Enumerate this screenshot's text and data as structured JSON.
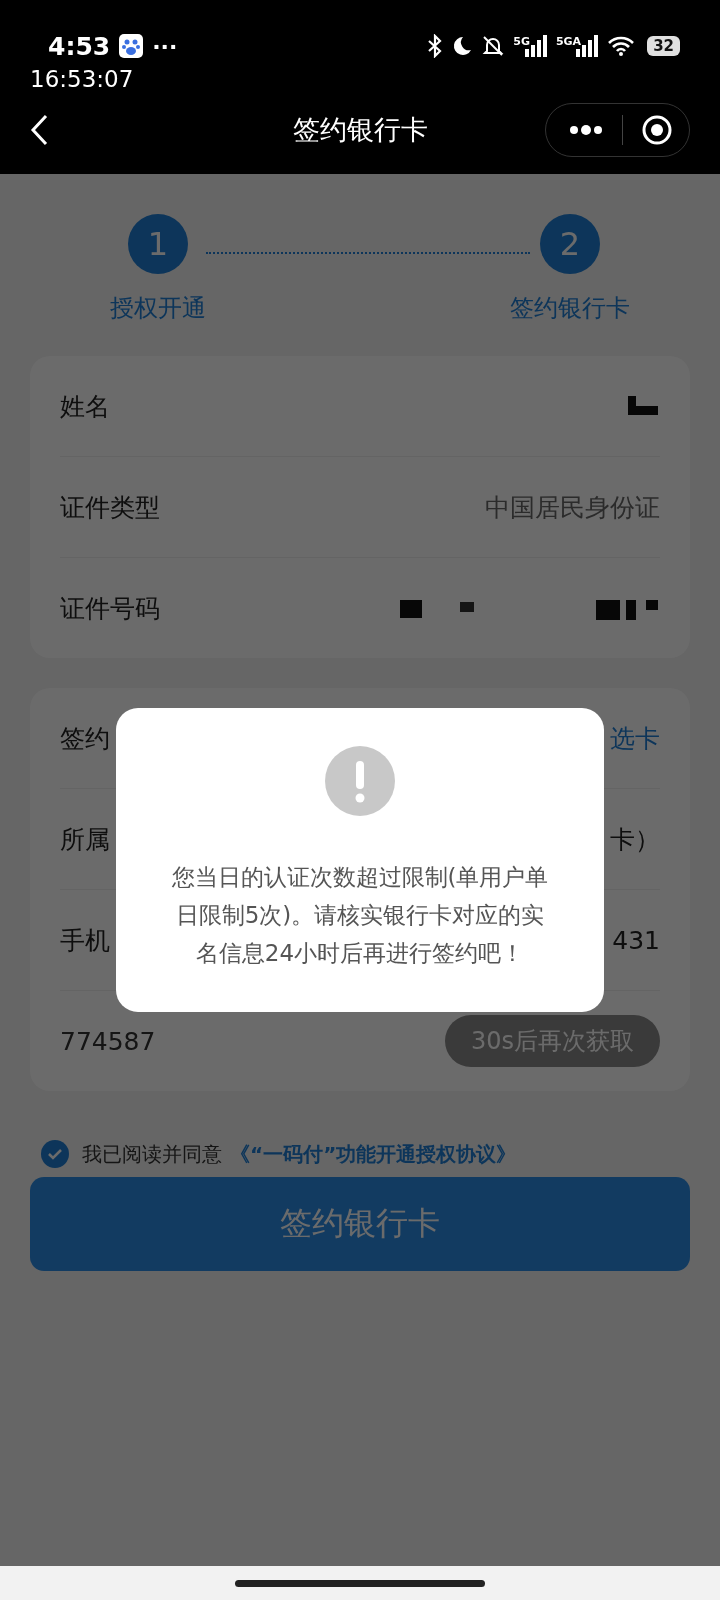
{
  "status_bar": {
    "time": "4:53",
    "more": "···",
    "clock": "16:53:07",
    "network_labels": [
      "5G",
      "5GA"
    ],
    "battery": "32"
  },
  "nav": {
    "title": "签约银行卡"
  },
  "steps": [
    {
      "number": "1",
      "label": "授权开通"
    },
    {
      "number": "2",
      "label": "签约银行卡"
    }
  ],
  "identity_rows": [
    {
      "kind": "redacted",
      "label": "姓名"
    },
    {
      "kind": "text",
      "label": "证件类型",
      "value": "中国居民身份证"
    },
    {
      "kind": "redacted",
      "label": "证件号码"
    }
  ],
  "bank_rows": [
    {
      "kind": "link",
      "label": "签约",
      "value": "选卡"
    },
    {
      "kind": "text",
      "label": "所属",
      "value": "卡）"
    },
    {
      "kind": "text",
      "label": "手机",
      "value": "431"
    },
    {
      "kind": "code",
      "value": "774587",
      "button": "30s后再次获取"
    }
  ],
  "agreement": {
    "checked": true,
    "text": "我已阅读并同意",
    "link": "《“一码付”功能开通授权协议》"
  },
  "submit": {
    "label": "签约银行卡"
  },
  "dialog": {
    "message": "您当日的认证次数超过限制(单用户单日限制5次)。请核实银行卡对应的实名信息24小时后再进行签约吧！"
  }
}
